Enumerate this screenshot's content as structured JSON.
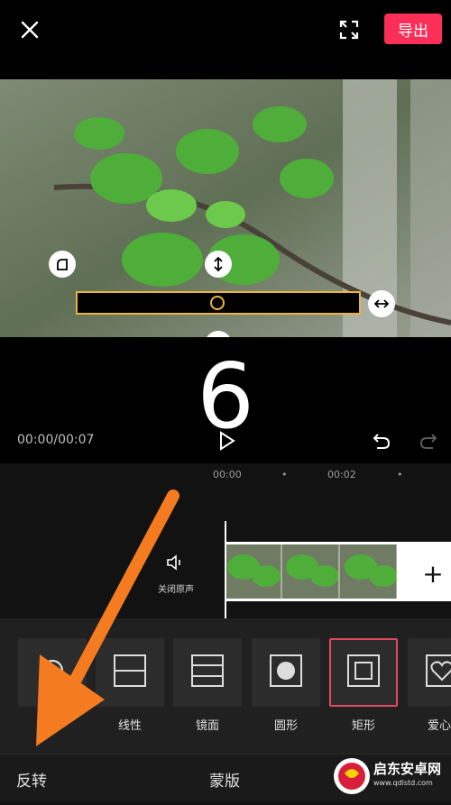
{
  "topbar": {
    "export_label": "导出"
  },
  "overlay": {
    "big_number": "6"
  },
  "playback": {
    "time": "00:00/00:07"
  },
  "timeline": {
    "ticks": [
      "00:00",
      "00:02"
    ]
  },
  "audio": {
    "mute_label": "关闭原声"
  },
  "clip": {
    "add_label": "+"
  },
  "masks": {
    "options": [
      {
        "label": "",
        "icon": "none-icon"
      },
      {
        "label": "线性",
        "icon": "linear-mask-icon"
      },
      {
        "label": "镜面",
        "icon": "mirror-mask-icon"
      },
      {
        "label": "圆形",
        "icon": "circle-mask-icon"
      },
      {
        "label": "矩形",
        "icon": "rectangle-mask-icon",
        "selected": true
      },
      {
        "label": "爱心",
        "icon": "heart-mask-icon"
      }
    ]
  },
  "bottombar": {
    "reverse_label": "反转",
    "title": "蒙版"
  },
  "watermark": {
    "brand": "启东安卓网",
    "url": "www.qdlstd.com"
  },
  "colors": {
    "accent": "#fb2f58",
    "mask_border": "#e9b53d",
    "selected_border": "#e44763",
    "arrow": "#f47b20"
  }
}
